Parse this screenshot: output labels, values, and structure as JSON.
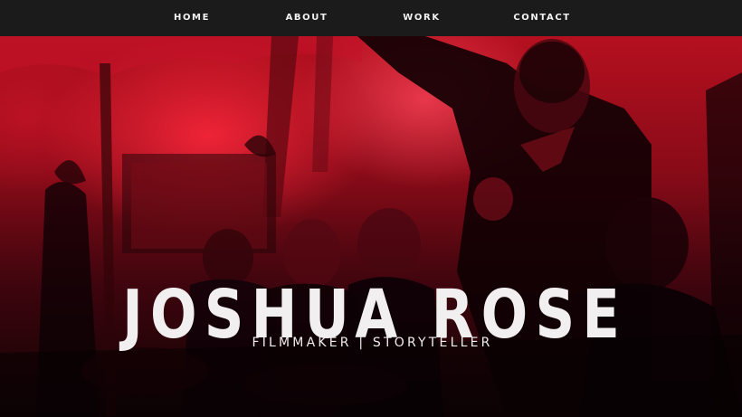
{
  "nav": {
    "items": [
      {
        "label": "HOME"
      },
      {
        "label": "ABOUT"
      },
      {
        "label": "WORK"
      },
      {
        "label": "CONTACT"
      }
    ]
  },
  "hero": {
    "title": "JOSHUA ROSE",
    "subtitle": "FILMMAKER | STORYTELLER"
  },
  "colors": {
    "nav_background": "#1b1b1b",
    "nav_text": "#f2f2f2",
    "hero_tint": "#b5101f",
    "hero_text": "#f1eff0"
  }
}
